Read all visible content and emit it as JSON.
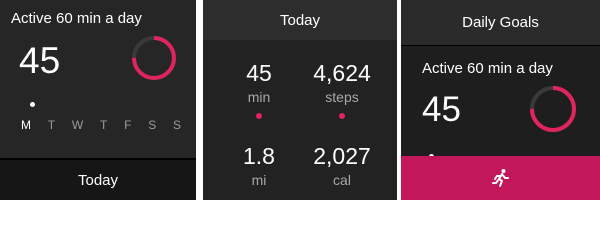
{
  "colors": {
    "accent": "#e0245e",
    "track": "#3a3a3a",
    "action_bar": "#c2185b"
  },
  "screen1": {
    "title": "Active 60 min a day",
    "value": "45",
    "progress_fraction": 0.75,
    "days": [
      "M",
      "T",
      "W",
      "T",
      "F",
      "S",
      "S"
    ],
    "active_day": "M",
    "bottom_label": "Today"
  },
  "screen2": {
    "header": "Today",
    "stats": [
      {
        "value": "45",
        "unit": "min"
      },
      {
        "value": "4,624",
        "unit": "steps"
      },
      {
        "value": "1.8",
        "unit": "mi"
      },
      {
        "value": "2,027",
        "unit": "cal"
      }
    ]
  },
  "screen3": {
    "header": "Daily Goals",
    "title": "Active 60 min a day",
    "value": "45",
    "progress_fraction": 0.75,
    "action_icon": "running-person-icon"
  }
}
